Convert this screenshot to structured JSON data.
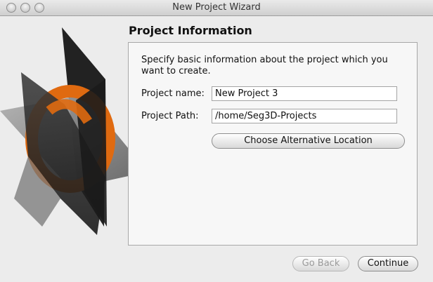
{
  "window": {
    "title": "New Project Wizard"
  },
  "page": {
    "title": "Project Information",
    "description": "Specify basic information about the project which you want to create."
  },
  "form": {
    "project_name_label": "Project name:",
    "project_name_value": "New Project 3",
    "project_path_label": "Project Path:",
    "project_path_value": "/home/Seg3D-Projects",
    "choose_location_label": "Choose Alternative Location"
  },
  "footer": {
    "back_label": "Go Back",
    "continue_label": "Continue"
  },
  "icons": {
    "logo": "seg3d-logo-icon"
  },
  "colors": {
    "accent_orange": "#e06a10",
    "dark_plane": "#2b2b2b",
    "light_plane": "#8a8a8a"
  }
}
